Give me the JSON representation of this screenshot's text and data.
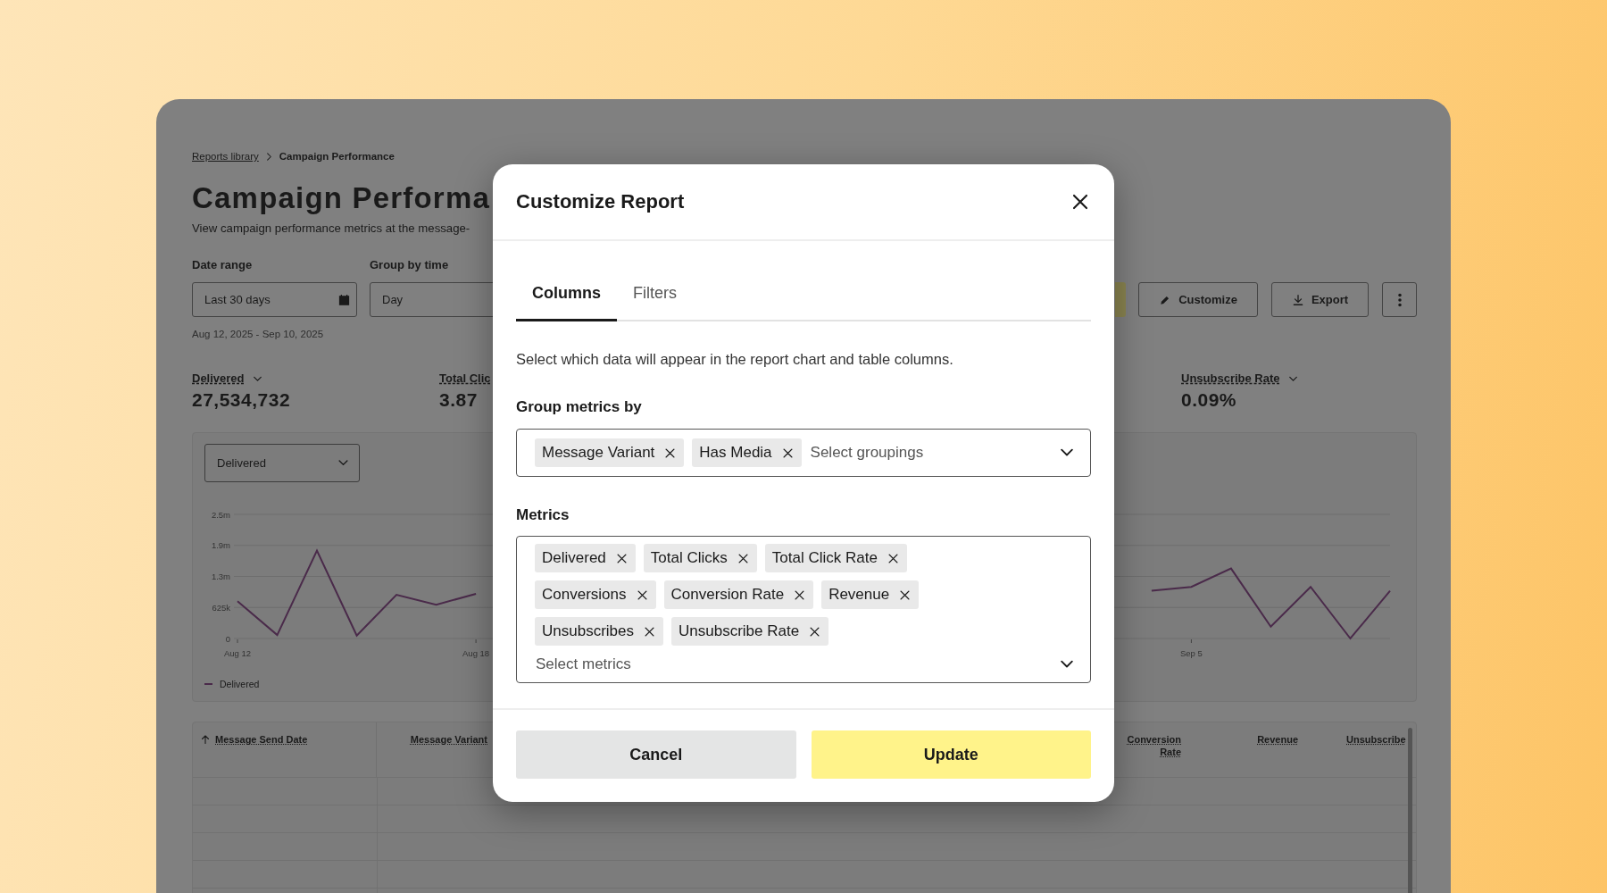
{
  "breadcrumb": [
    {
      "label": "Reports library",
      "kind": "link"
    },
    {
      "label": "Campaign Performance",
      "kind": "current"
    }
  ],
  "page": {
    "title": "Campaign Performa",
    "subtitle": "View campaign performance metrics at the message-"
  },
  "filters": [
    {
      "label": "Date range",
      "value": "Last 30 days",
      "kind": "date"
    },
    {
      "label": "Group by time",
      "value": "Day",
      "kind": "select"
    }
  ],
  "date_summary": "Aug 12, 2025 - Sep 10, 2025",
  "actions": [
    {
      "kind": "primary"
    },
    {
      "label": "Customize",
      "kind": "edit"
    },
    {
      "label": "Export",
      "kind": "download"
    },
    {
      "kind": "more"
    }
  ],
  "kpis": [
    {
      "label": "Delivered",
      "value": "27,534,732",
      "menu": true
    },
    {
      "label": "Total Clic",
      "value": "3.87",
      "menu": false
    },
    {
      "label": "Unsubscribe Rate",
      "value": "0.09%",
      "menu": true
    }
  ],
  "chart": {
    "metric": "Delivered",
    "chart_data": {
      "type": "line",
      "categories": [
        "Aug 12",
        null,
        null,
        null,
        null,
        null,
        "Aug 18",
        null,
        null,
        null,
        null,
        null,
        null,
        null,
        null,
        null,
        null,
        null,
        null,
        null,
        null,
        null,
        null,
        null,
        "Sep 5",
        null,
        null,
        null,
        null,
        null
      ],
      "series": [
        {
          "name": "Delivered",
          "color": "#4a2a4a",
          "values": [
            750000,
            70000,
            1770000,
            60000,
            880000,
            680000,
            900000,
            null,
            null,
            null,
            null,
            null,
            null,
            null,
            null,
            null,
            null,
            null,
            null,
            null,
            null,
            null,
            null,
            960000,
            1040000,
            1410000,
            240000,
            1040000,
            0,
            960000
          ]
        }
      ],
      "yticks": [
        {
          "value": 0,
          "label": "0"
        },
        {
          "value": 625000,
          "label": "625k"
        },
        {
          "value": 1250000,
          "label": "1.3m"
        },
        {
          "value": 1875000,
          "label": "1.9m"
        },
        {
          "value": 2500000,
          "label": "2.5m"
        }
      ],
      "ylim": [
        0,
        2500000
      ],
      "grid": true
    }
  },
  "table": {
    "columns": [
      {
        "label": "Message Send Date",
        "sorted": true
      },
      {
        "label": "Message Variant",
        "sorted": false
      },
      {
        "label": "Conversion Rate",
        "sorted": false
      },
      {
        "label": "Revenue",
        "sorted": false
      },
      {
        "label": "Unsubscribe",
        "sorted": false
      }
    ]
  },
  "modal": {
    "title": "Customize Report",
    "tabs": [
      {
        "label": "Columns",
        "selected": true
      },
      {
        "label": "Filters",
        "selected": false
      }
    ],
    "description": "Select which data will appear in the report chart and table columns.",
    "groupings": {
      "label": "Group metrics by",
      "chips": [
        "Message Variant",
        "Has Media"
      ],
      "placeholder": "Select groupings"
    },
    "metrics": {
      "label": "Metrics",
      "chips": [
        "Delivered",
        "Total Clicks",
        "Total Click Rate",
        "Conversions",
        "Conversion Rate",
        "Revenue",
        "Unsubscribes",
        "Unsubscribe Rate"
      ],
      "placeholder": "Select metrics"
    },
    "buttons": [
      {
        "label": "Cancel",
        "kind": "secondary"
      },
      {
        "label": "Update",
        "kind": "primary"
      }
    ]
  }
}
